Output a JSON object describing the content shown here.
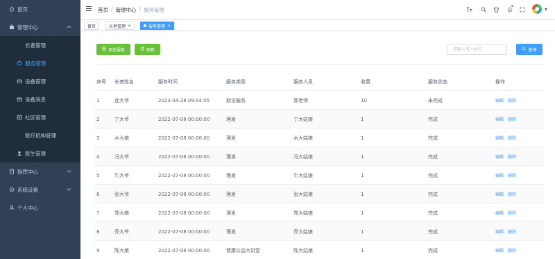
{
  "sidebar": {
    "items": [
      {
        "label": "首页",
        "icon": "home-icon"
      },
      {
        "label": "管理中心",
        "icon": "suitcase-icon"
      },
      {
        "label": "长者管理"
      },
      {
        "label": "服务管理",
        "icon": "service-icon"
      },
      {
        "label": "设备管理",
        "icon": "device-icon"
      },
      {
        "label": "设备消息",
        "icon": "message-icon"
      },
      {
        "label": "社区管理",
        "icon": "community-icon"
      },
      {
        "label": "医疗机构管理"
      },
      {
        "label": "医生管理",
        "icon": "user-icon"
      },
      {
        "label": "指挥中心",
        "icon": "command-icon"
      },
      {
        "label": "系统设置",
        "icon": "settings-icon"
      },
      {
        "label": "个人中心",
        "icon": "person-icon"
      }
    ]
  },
  "header": {
    "breadcrumb": [
      "首页",
      "管理中心",
      "服务管理"
    ],
    "separator": "/"
  },
  "tags": [
    {
      "label": "首页"
    },
    {
      "label": "长者管理",
      "close": "×"
    },
    {
      "label": "服务管理",
      "close": "×"
    }
  ],
  "toolbar": {
    "add_label": "添加服务",
    "refresh_label": "刷新",
    "search_placeholder": "请输入老人姓名",
    "search_label": "查询"
  },
  "table": {
    "columns": [
      "序号",
      "长者姓名",
      "服务时间",
      "服务类型",
      "服务人员",
      "收费",
      "服务状态",
      "操作"
    ],
    "edit_label": "编辑",
    "delete_label": "删除",
    "rows": [
      {
        "no": "1",
        "name": "连大爷",
        "time": "2023-04-28 09:04:05",
        "type": "助浴服务",
        "staff": "郭老师",
        "fee": "10",
        "status": "未完成"
      },
      {
        "no": "2",
        "name": "丁大爷",
        "time": "2022-07-08 00:00:00",
        "type": "理发",
        "staff": "丁大姑娘",
        "fee": "1",
        "status": "完成"
      },
      {
        "no": "3",
        "name": "木大娘",
        "time": "2022-07-08 00:00:00",
        "type": "理发",
        "staff": "木大姑娘",
        "fee": "1",
        "status": "完成"
      },
      {
        "no": "4",
        "name": "冯大爷",
        "time": "2022-07-08 00:00:00",
        "type": "理发",
        "staff": "冯大姑娘",
        "fee": "1",
        "status": "完成"
      },
      {
        "no": "5",
        "name": "牛大爷",
        "time": "2022-07-08 00:00:00",
        "type": "理发",
        "staff": "牛大姑娘",
        "fee": "1",
        "status": "完成"
      },
      {
        "no": "6",
        "name": "张大爷",
        "time": "2022-07-08 00:00:00",
        "type": "理发",
        "staff": "张大姑娘",
        "fee": "1",
        "status": "完成"
      },
      {
        "no": "7",
        "name": "郑大娘",
        "time": "2022-07-08 00:00:00",
        "type": "理发",
        "staff": "郑大姑娘",
        "fee": "1",
        "status": "完成"
      },
      {
        "no": "8",
        "name": "乔大爷",
        "time": "2022-07-08 00:00:00",
        "type": "理发",
        "staff": "乔大姑娘",
        "fee": "1",
        "status": "完成"
      },
      {
        "no": "9",
        "name": "陈大娘",
        "time": "2022-07-06 00:00:00",
        "type": "健康公益大讲堂",
        "staff": "陈大姑娘",
        "fee": "1",
        "status": "完成"
      }
    ]
  },
  "colors": {
    "sidebar_bg": "#304156",
    "accent": "#409eff",
    "success": "#67c23a"
  }
}
